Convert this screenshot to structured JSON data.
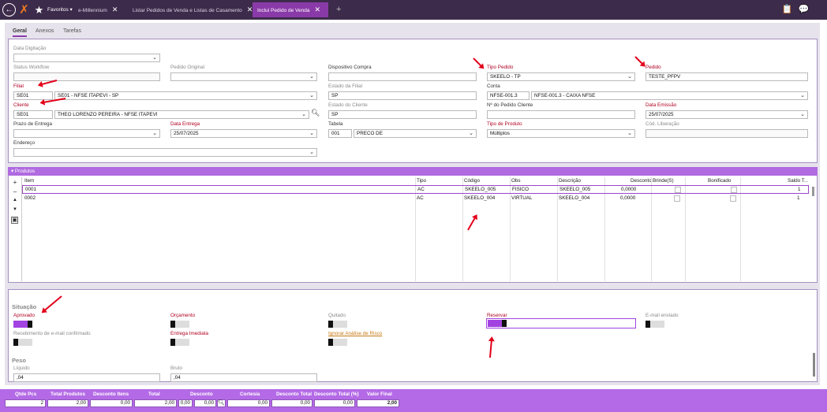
{
  "topbar": {
    "favoritos": "Favoritos",
    "tabs": [
      {
        "label": "e-Millennium"
      },
      {
        "label": "Listar Pedidos de Venda e Listas de Casamento"
      },
      {
        "label": "Inclui Pedido de Venda"
      }
    ],
    "close_glyph": "✕",
    "add_glyph": "+"
  },
  "form_tabs": [
    "Geral",
    "Anexos",
    "Tarefas"
  ],
  "form": {
    "data_digitacao": {
      "label": "Data Digitação",
      "value": ""
    },
    "status_workflow": {
      "label": "Status Workflow",
      "value": ""
    },
    "pedido_original": {
      "label": "Pedido Original",
      "value": ""
    },
    "dispositivo_compra": {
      "label": "Dispositivo Compra",
      "value": ""
    },
    "tipo_pedido": {
      "label": "Tipo Pedido",
      "value": "SKEELO - TP"
    },
    "pedido": {
      "label": "Pedido",
      "value": "TESTE_PFPV"
    },
    "filial": {
      "label": "Filial",
      "code": "SE01",
      "name": "SE01 - NFSE ITAPEVI - SP"
    },
    "estado_filial": {
      "label": "Estado da Filial",
      "value": "SP"
    },
    "conta": {
      "label": "Conta",
      "code": "NFSE-001.3",
      "name": "NFSE-001.3 - CAIXA NFSE"
    },
    "cliente": {
      "label": "Cliente",
      "code": "SE01",
      "name": "THEO LORENZO PEREIRA - NFSE ITAPEVI"
    },
    "estado_cliente": {
      "label": "Estado do Cliente",
      "value": "SP"
    },
    "pedido_cliente": {
      "label": "Nº do Pedido Cliente",
      "value": ""
    },
    "data_emissao": {
      "label": "Data Emissão",
      "value": "25/07/2025"
    },
    "prazo_entrega": {
      "label": "Prazo de Entrega",
      "value": ""
    },
    "data_entrega": {
      "label": "Data Entrega",
      "value": "25/07/2025"
    },
    "tabela": {
      "label": "Tabela",
      "code": "001",
      "name": "PRECO DE"
    },
    "tipo_produto": {
      "label": "Tipo de Produto",
      "value": "Múltiplos"
    },
    "cod_liberacao": {
      "label": "Cód. Liberação",
      "value": ""
    },
    "endereco": {
      "label": "Endereço",
      "value": ""
    }
  },
  "produtos": {
    "title": "▾ Produtos",
    "columns": [
      "Item",
      "Tipo",
      "Código",
      "Obs",
      "Descrição",
      "Desconto",
      "Brinde(S)",
      "Bonificado",
      "Saldo T..."
    ],
    "rows": [
      {
        "item": "0001",
        "tipo": "AC",
        "codigo": "SKEELO_005",
        "obs": "FISICO",
        "descricao": "SKEELO_005",
        "desconto": "0,0000",
        "saldo": "1"
      },
      {
        "item": "0002",
        "tipo": "AC",
        "codigo": "SKEELO_004",
        "obs": "VIRTUAL",
        "descricao": "SKEELO_004",
        "desconto": "0,0000",
        "saldo": "1"
      }
    ]
  },
  "situacao": {
    "title": "Situação",
    "aprovado": "Aprovado",
    "orcamento": "Orçamento",
    "quitado": "Quitado",
    "reservar": "Reservar",
    "email_enviado": "E-mail enviado",
    "recebimento": "Recebimento de e-mail confirmado",
    "entrega_imediata": "Entrega Imediata",
    "ignorar": "Ignorar Análise de Risco"
  },
  "peso": {
    "title": "Peso",
    "liquido_label": "Líquido",
    "liquido": ",04",
    "bruto_label": "Bruto",
    "bruto": ",04"
  },
  "footer": [
    {
      "label": "Qtde Pcs",
      "value": "2"
    },
    {
      "label": "Total Produtos",
      "value": "2,00"
    },
    {
      "label": "Desconto Itens",
      "value": "0,00"
    },
    {
      "label": "Total",
      "value": "2,00"
    },
    {
      "label": "Desconto",
      "value": "0,00",
      "value2": "0,00"
    },
    {
      "label": "Cortesia",
      "value": "0,00"
    },
    {
      "label": "Desconto Total",
      "value": "0,00"
    },
    {
      "label": "Desconto Total (%)",
      "value": "0,00"
    },
    {
      "label": "Valor Final",
      "value": "2,00"
    }
  ],
  "colors": {
    "accent": "#b06be0",
    "topbar": "#3d2b4b",
    "arrow": "#e2001a"
  }
}
